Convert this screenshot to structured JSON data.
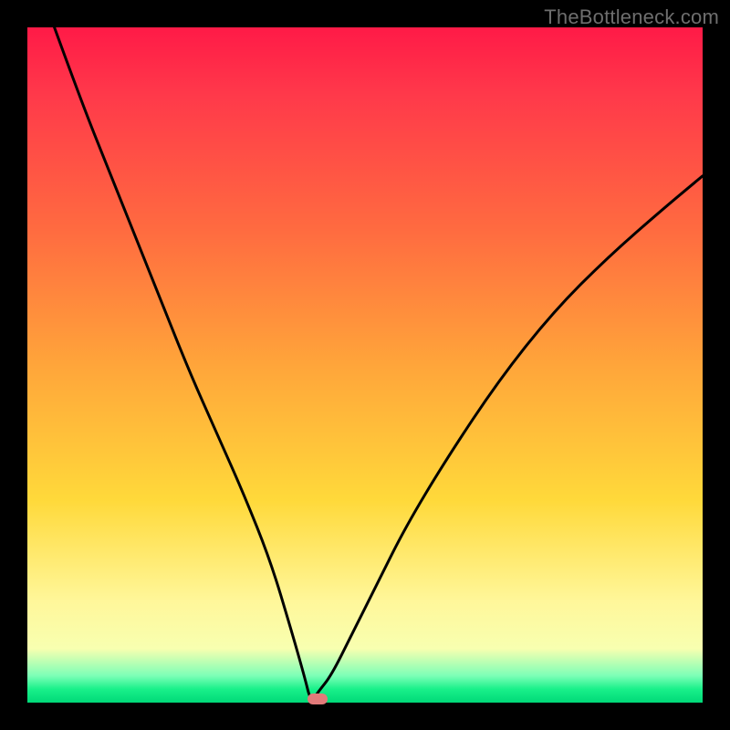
{
  "watermark": "TheBottleneck.com",
  "colors": {
    "frame": "#000000",
    "gradient_top": "#ff1a47",
    "gradient_mid": "#ffd93a",
    "gradient_bottom": "#00d978",
    "curve": "#000000",
    "marker": "#e27a7a"
  },
  "chart_data": {
    "type": "line",
    "title": "",
    "xlabel": "",
    "ylabel": "",
    "xlim": [
      0,
      100
    ],
    "ylim": [
      0,
      100
    ],
    "legend": false,
    "grid": false,
    "notes": "V-shaped bottleneck curve over vertical red→green gradient. Minimum (y≈0) near x≈42. Left branch starts at top-left corner (x≈4, y=100) and descends steeply. Right branch rises from the minimum toward upper-right, exiting right edge near y≈78.",
    "series": [
      {
        "name": "bottleneck-curve",
        "x": [
          4,
          8,
          12,
          16,
          20,
          24,
          28,
          32,
          36,
          39,
          41,
          42,
          43,
          45,
          48,
          52,
          56,
          62,
          70,
          78,
          86,
          94,
          100
        ],
        "y": [
          100,
          89,
          79,
          69,
          59,
          49,
          40,
          31,
          21,
          11,
          4,
          0,
          1.5,
          4,
          10,
          18,
          26,
          36,
          48,
          58,
          66,
          73,
          78
        ]
      }
    ],
    "marker": {
      "x": 43,
      "y": 0.5
    }
  }
}
